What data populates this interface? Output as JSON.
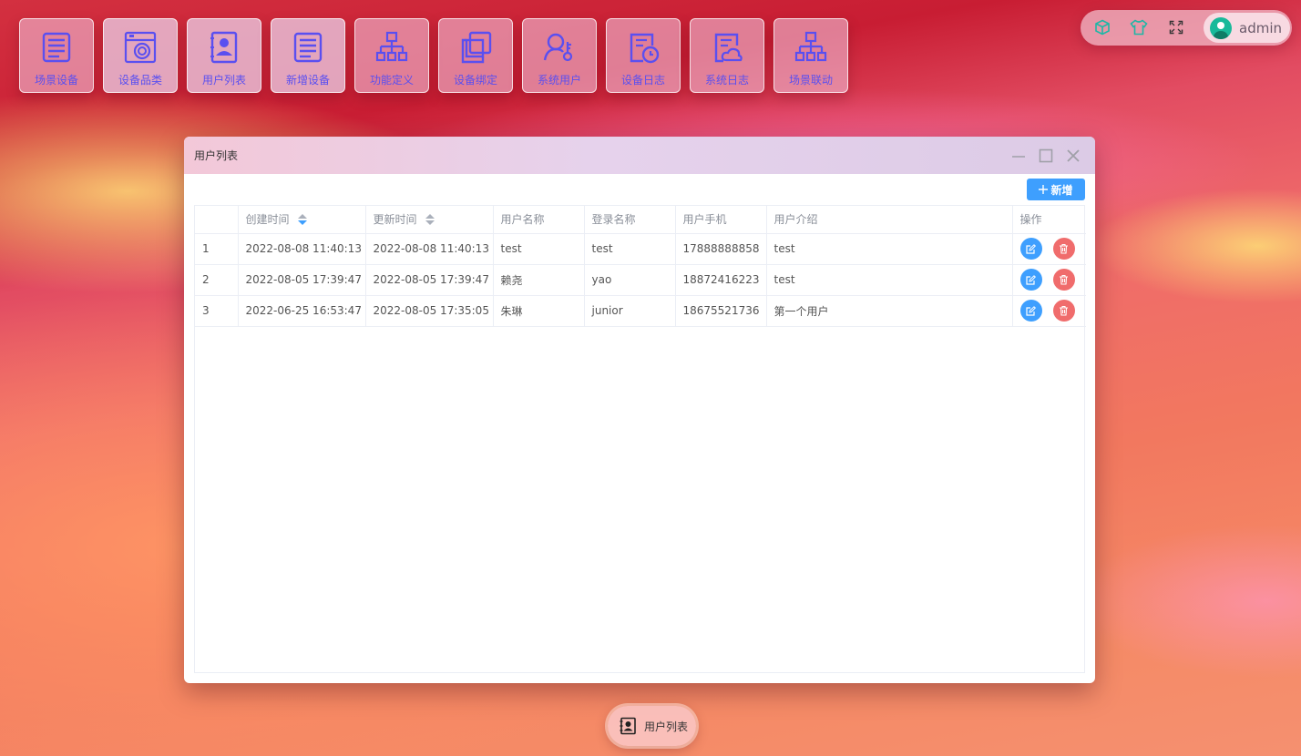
{
  "desktop_icons": [
    {
      "label": "场景设备",
      "icon": "list-icon"
    },
    {
      "label": "设备品类",
      "icon": "washer-icon"
    },
    {
      "label": "用户列表",
      "icon": "contact-card-icon"
    },
    {
      "label": "新增设备",
      "icon": "list-icon"
    },
    {
      "label": "功能定义",
      "icon": "org-chart-icon"
    },
    {
      "label": "设备绑定",
      "icon": "copy-icon"
    },
    {
      "label": "系统用户",
      "icon": "user-key-icon"
    },
    {
      "label": "设备日志",
      "icon": "doc-clock-icon"
    },
    {
      "label": "系统日志",
      "icon": "doc-cloud-icon"
    },
    {
      "label": "场景联动",
      "icon": "org-chart-icon"
    }
  ],
  "topbar": {
    "icons": [
      "cube-icon",
      "tshirt-icon",
      "fullscreen-icon"
    ],
    "user_name": "admin"
  },
  "window": {
    "title": "用户列表",
    "add_label": "新增",
    "columns": [
      "",
      "创建时间",
      "更新时间",
      "用户名称",
      "登录名称",
      "用户手机",
      "用户介绍",
      "操作"
    ],
    "rows": [
      {
        "index": "1",
        "created": "2022-08-08 11:40:13",
        "updated": "2022-08-08 11:40:13",
        "name": "test",
        "login": "test",
        "phone": "17888888858",
        "intro": "test"
      },
      {
        "index": "2",
        "created": "2022-08-05 17:39:47",
        "updated": "2022-08-05 17:39:47",
        "name": "赖尧",
        "login": "yao",
        "phone": "18872416223",
        "intro": "test"
      },
      {
        "index": "3",
        "created": "2022-06-25 16:53:47",
        "updated": "2022-08-05 17:35:05",
        "name": "朱琳",
        "login": "junior",
        "phone": "18675521736",
        "intro": "第一个用户"
      }
    ]
  },
  "taskbar": {
    "label": "用户列表",
    "icon": "contact-card-icon"
  },
  "colors": {
    "accent": "#3e9ffe",
    "danger": "#f06c6c",
    "icon": "#5a4ff0"
  }
}
